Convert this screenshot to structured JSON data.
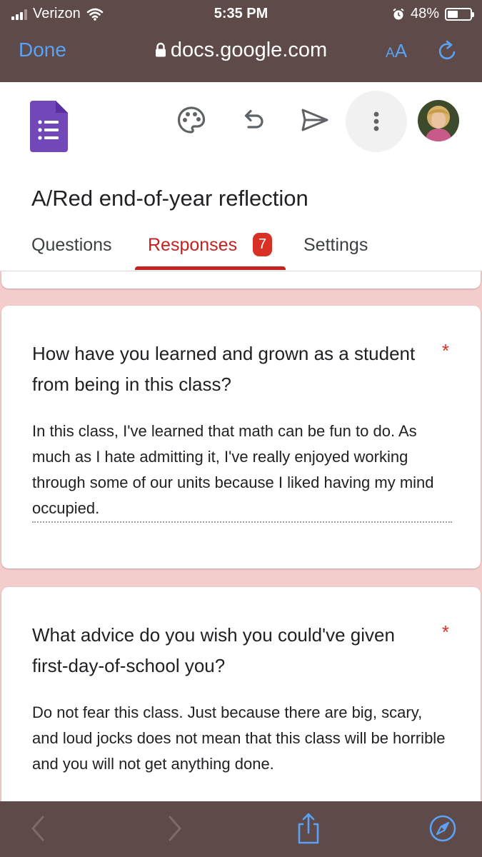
{
  "status": {
    "carrier": "Verizon",
    "time": "5:35 PM",
    "battery": "48%"
  },
  "browser": {
    "done_label": "Done",
    "url": "docs.google.com",
    "aa_small": "A",
    "aa_large": "A"
  },
  "form": {
    "title": "A/Red end-of-year reflection",
    "tabs": [
      {
        "label": "Questions"
      },
      {
        "label": "Responses",
        "badge": "7"
      },
      {
        "label": "Settings"
      }
    ]
  },
  "responses": [
    {
      "question": "How have you learned and grown as a student from being in this class?",
      "required_mark": "*",
      "answer": "In this class, I've learned that math can be fun to do. As much as I hate admitting it, I've really enjoyed working through some of our units because I liked having my mind occupied."
    },
    {
      "question": "What advice do you wish you could've given first-day-of-school you?",
      "required_mark": "*",
      "answer": "Do not fear this class. Just because there are big, scary, and loud jocks does not mean that this class will be horrible and you will not get anything done."
    }
  ],
  "colors": {
    "accent_red": "#c5221f",
    "safari_blue": "#5aa2f6",
    "chrome_bg": "#5e4a48",
    "forms_purple": "#673ab7",
    "page_bg": "#f3cccc"
  },
  "icons": [
    "signal-icon",
    "wifi-icon",
    "alarm-icon",
    "battery-icon",
    "lock-icon",
    "reload-icon",
    "google-forms-logo-icon",
    "palette-icon",
    "undo-icon",
    "send-icon",
    "more-vert-icon",
    "back-icon",
    "forward-icon",
    "share-icon",
    "compass-icon"
  ]
}
